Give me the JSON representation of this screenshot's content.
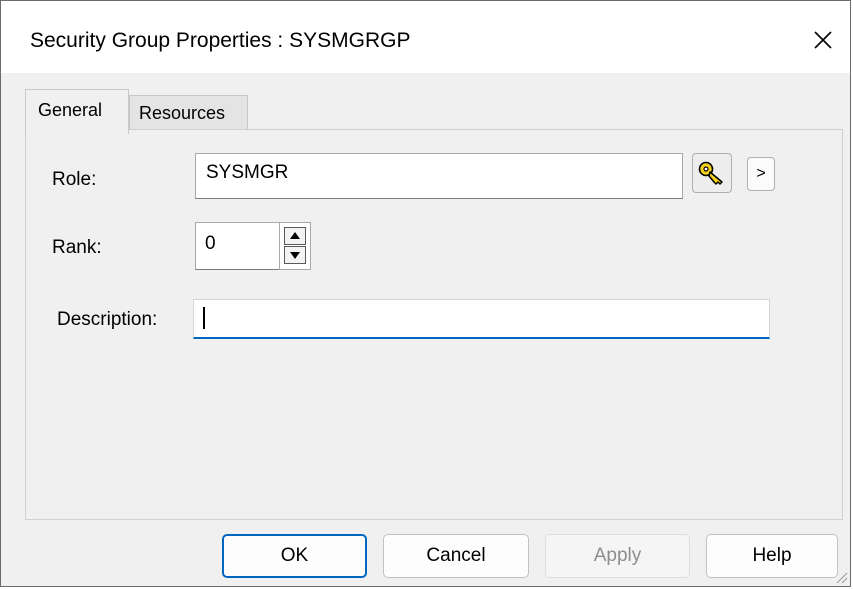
{
  "window": {
    "title": "Security Group Properties : SYSMGRGP",
    "close_icon": "close-icon"
  },
  "tabs": [
    {
      "label": "General",
      "selected": true
    },
    {
      "label": "Resources",
      "selected": false
    }
  ],
  "form": {
    "role_label": "Role:",
    "role_value": "SYSMGR",
    "rank_label": "Rank:",
    "rank_value": "0",
    "description_label": "Description:",
    "description_value": "",
    "key_icon": "key-icon",
    "more_label": ">"
  },
  "buttons": {
    "ok": "OK",
    "cancel": "Cancel",
    "apply": "Apply",
    "help": "Help"
  },
  "colors": {
    "accent": "#0067c0",
    "key_gold": "#f2d21b"
  }
}
